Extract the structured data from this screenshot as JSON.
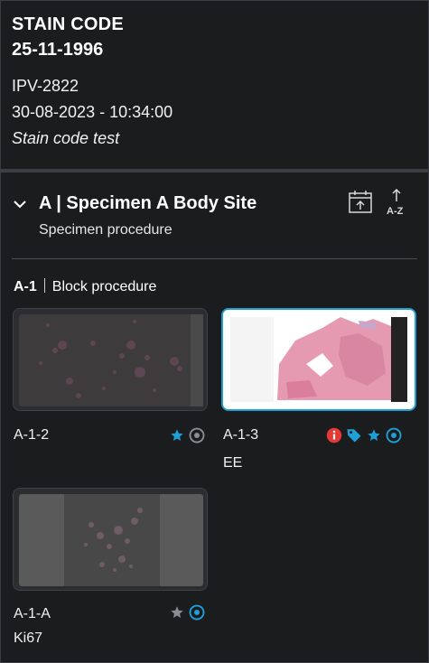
{
  "header": {
    "title": "STAIN CODE",
    "date": "25-11-1996",
    "case_id": "IPV-2822",
    "timestamp": "30-08-2023 - 10:34:00",
    "note": "Stain code test"
  },
  "specimen": {
    "title": "A | Specimen A Body Site",
    "procedure": "Specimen procedure",
    "actions": [
      "calendar-sort-icon",
      "sort-az-icon"
    ]
  },
  "block": {
    "id": "A-1",
    "procedure": "Block procedure"
  },
  "slides": [
    {
      "label": "A-1-2",
      "stain": "",
      "selected": false,
      "icons": [
        "star-icon",
        "eye-icon"
      ]
    },
    {
      "label": "A-1-3",
      "stain": "EE",
      "selected": true,
      "icons": [
        "info-icon",
        "tag-icon",
        "star-icon",
        "eye-icon"
      ]
    },
    {
      "label": "A-1-A",
      "stain": "Ki67",
      "selected": false,
      "icons": [
        "star-icon",
        "eye-icon"
      ]
    }
  ],
  "colors": {
    "background": "#1b1c1e",
    "accent": "#1e9fd6",
    "alert": "#e53935",
    "muted_icon": "#8a8d91"
  }
}
